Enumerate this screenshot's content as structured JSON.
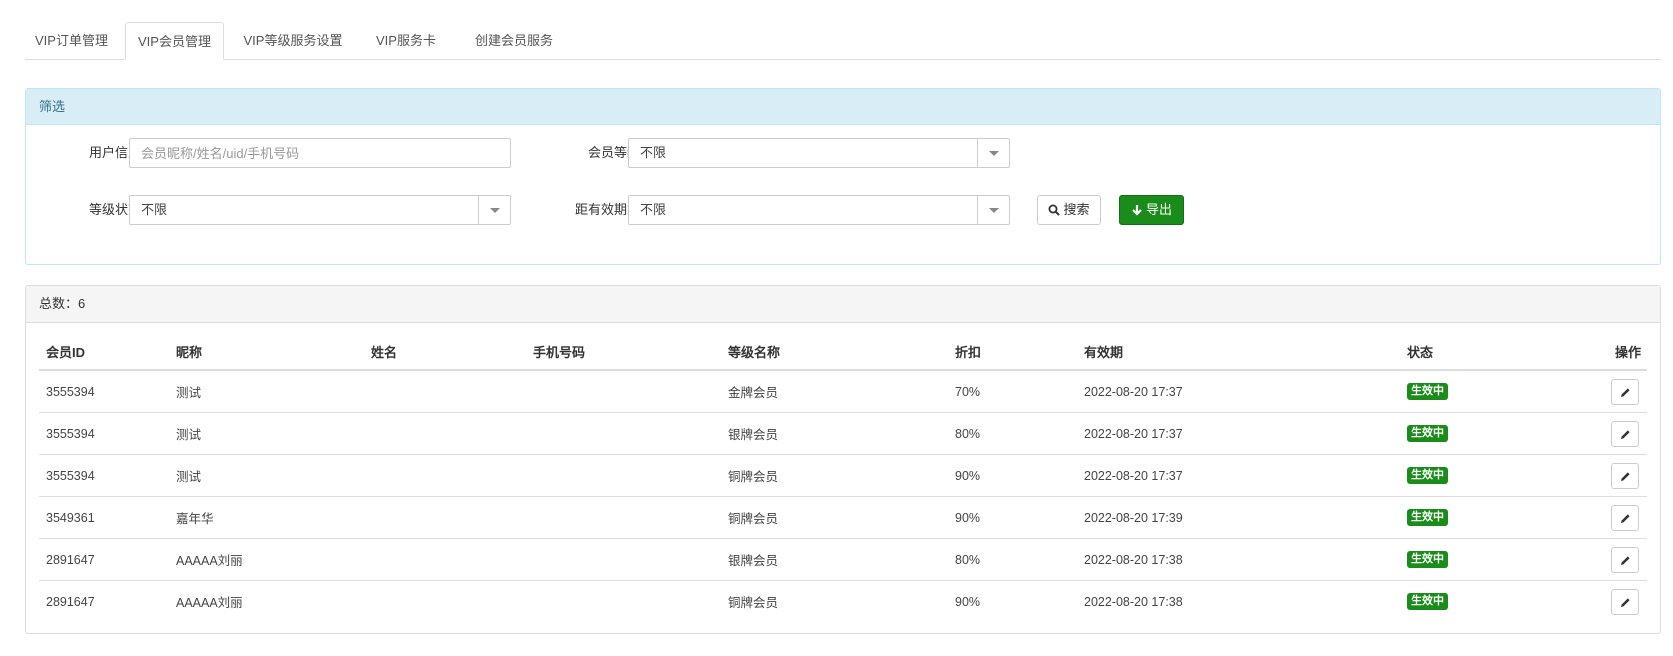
{
  "tabs": [
    {
      "label": "VIP订单管理",
      "active": false
    },
    {
      "label": "VIP会员管理",
      "active": true
    },
    {
      "label": "VIP等级服务设置",
      "active": false
    },
    {
      "label": "VIP服务卡",
      "active": false
    },
    {
      "label": "创建会员服务",
      "active": false
    }
  ],
  "filter": {
    "title": "筛选",
    "user_info_label": "用户信息",
    "user_info_placeholder": "会员昵称/姓名/uid/手机号码",
    "user_info_value": "",
    "level_label": "会员等级",
    "level_value": "不限",
    "level_status_label": "等级状态",
    "level_status_value": "不限",
    "expiry_label": "距有效期剩",
    "expiry_value": "不限",
    "search_label": "搜索",
    "export_label": "导出"
  },
  "results": {
    "total_text": "总数：6",
    "columns": [
      "会员ID",
      "昵称",
      "姓名",
      "手机号码",
      "等级名称",
      "折扣",
      "有效期",
      "状态",
      "操作"
    ],
    "rows": [
      {
        "id": "3555394",
        "nickname": "测试",
        "name": "",
        "phone": "",
        "level": "金牌会员",
        "discount": "70%",
        "expiry": "2022-08-20 17:37",
        "status": "生效中"
      },
      {
        "id": "3555394",
        "nickname": "测试",
        "name": "",
        "phone": "",
        "level": "银牌会员",
        "discount": "80%",
        "expiry": "2022-08-20 17:37",
        "status": "生效中"
      },
      {
        "id": "3555394",
        "nickname": "测试",
        "name": "",
        "phone": "",
        "level": "铜牌会员",
        "discount": "90%",
        "expiry": "2022-08-20 17:37",
        "status": "生效中"
      },
      {
        "id": "3549361",
        "nickname": "嘉年华",
        "name": "",
        "phone": "",
        "level": "铜牌会员",
        "discount": "90%",
        "expiry": "2022-08-20 17:39",
        "status": "生效中"
      },
      {
        "id": "2891647",
        "nickname": "AAAAA刘丽",
        "name": "",
        "phone": "",
        "level": "银牌会员",
        "discount": "80%",
        "expiry": "2022-08-20 17:38",
        "status": "生效中"
      },
      {
        "id": "2891647",
        "nickname": "AAAAA刘丽",
        "name": "",
        "phone": "",
        "level": "铜牌会员",
        "discount": "90%",
        "expiry": "2022-08-20 17:38",
        "status": "生效中"
      }
    ]
  },
  "colors": {
    "accent_green": "#1a8c1a",
    "info_bg": "#d9edf7",
    "info_text": "#31708f"
  },
  "icons": {
    "search": "search-icon",
    "export": "arrow-down-icon",
    "edit": "pencil-icon"
  }
}
